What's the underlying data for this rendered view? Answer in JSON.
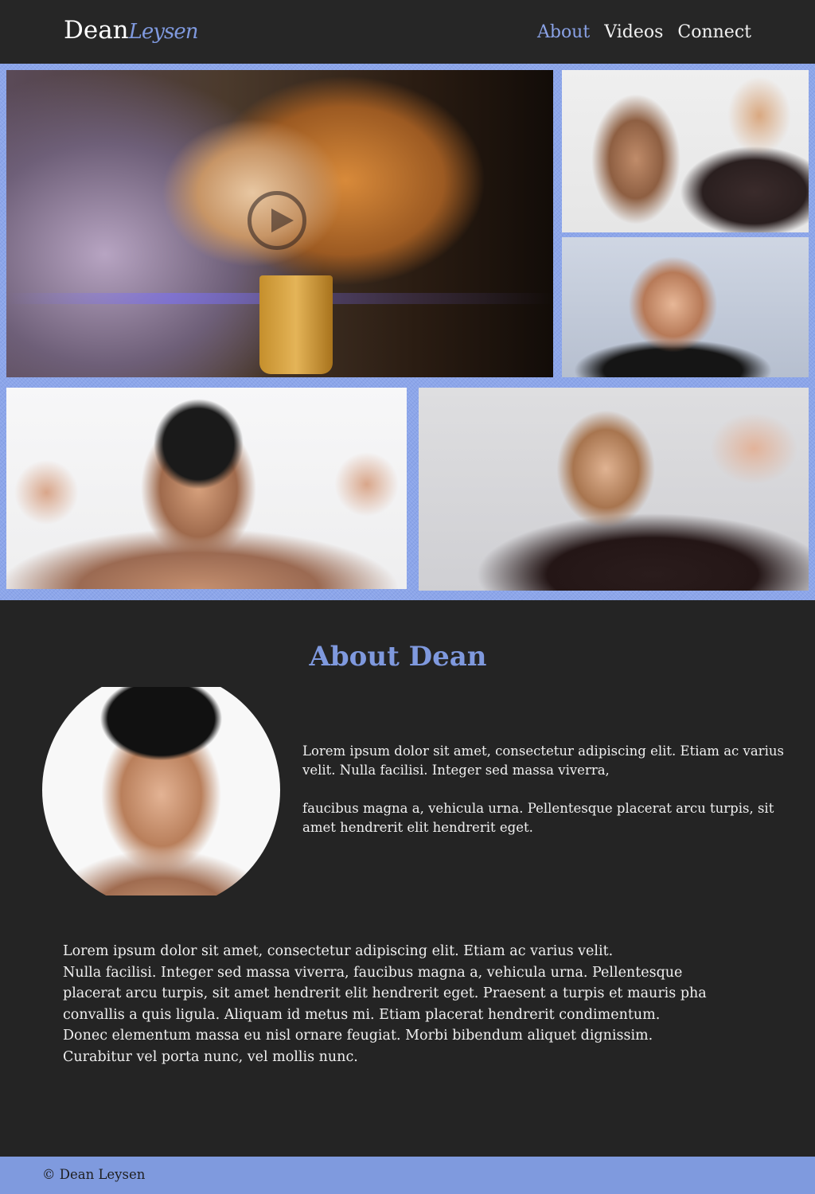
{
  "header": {
    "logo_main": "Dean",
    "logo_script": "Leysen",
    "nav": [
      {
        "label": "About",
        "active": true
      },
      {
        "label": "Videos",
        "active": false
      },
      {
        "label": "Connect",
        "active": false
      }
    ]
  },
  "gallery": {
    "icons": {
      "play": "play-icon"
    }
  },
  "about": {
    "title": "About Dean",
    "intro_lines": [
      "Lorem ipsum dolor sit amet, consectetur adipiscing elit. Etiam ac varius velit. Nulla facilisi. Integer sed massa viverra,",
      "faucibus magna a, vehicula urna. Pellentesque placerat arcu turpis, sit amet hendrerit elit hendrerit eget."
    ],
    "body_lines": [
      "Lorem ipsum dolor sit amet, consectetur adipiscing elit. Etiam ac varius velit.",
      "Nulla facilisi. Integer sed massa viverra, faucibus magna a, vehicula urna. Pellentesque",
      "placerat arcu turpis, sit amet hendrerit elit hendrerit eget. Praesent a turpis et mauris pha",
      "convallis a quis ligula. Aliquam id metus mi. Etiam placerat hendrerit condimentum.",
      "Donec elementum massa eu nisl ornare feugiat. Morbi bibendum aliquet dignissim.",
      "Curabitur vel porta nunc, vel mollis nunc."
    ]
  },
  "footer": {
    "copyright": "© Dean Leysen"
  },
  "colors": {
    "accent": "#7f99de",
    "background": "#242424",
    "text": "#f0f0f0"
  }
}
